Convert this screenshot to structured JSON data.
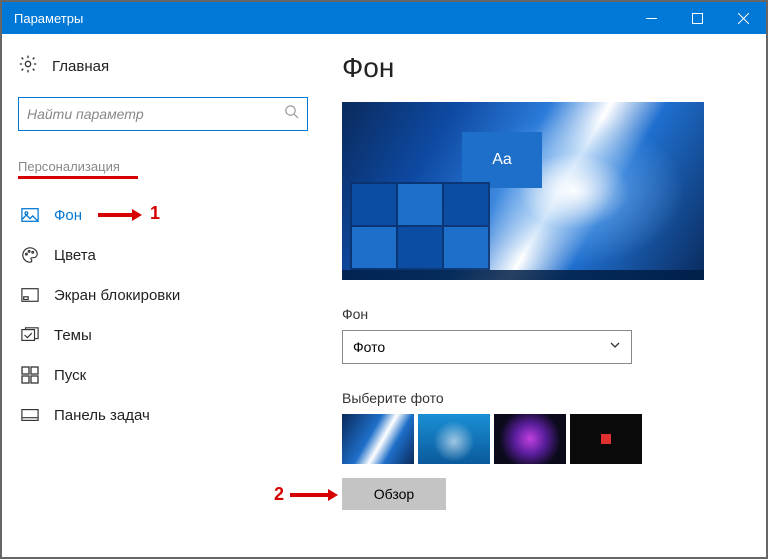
{
  "window": {
    "title": "Параметры"
  },
  "sidebar": {
    "home_label": "Главная",
    "search_placeholder": "Найти параметр",
    "category": "Персонализация",
    "items": [
      {
        "label": "Фон"
      },
      {
        "label": "Цвета"
      },
      {
        "label": "Экран блокировки"
      },
      {
        "label": "Темы"
      },
      {
        "label": "Пуск"
      },
      {
        "label": "Панель задач"
      }
    ]
  },
  "main": {
    "title": "Фон",
    "preview_sample": "Aa",
    "background_label": "Фон",
    "background_dropdown_value": "Фото",
    "choose_photo_label": "Выберите фото",
    "browse_button": "Обзор"
  },
  "annotations": {
    "one": "1",
    "two": "2"
  }
}
